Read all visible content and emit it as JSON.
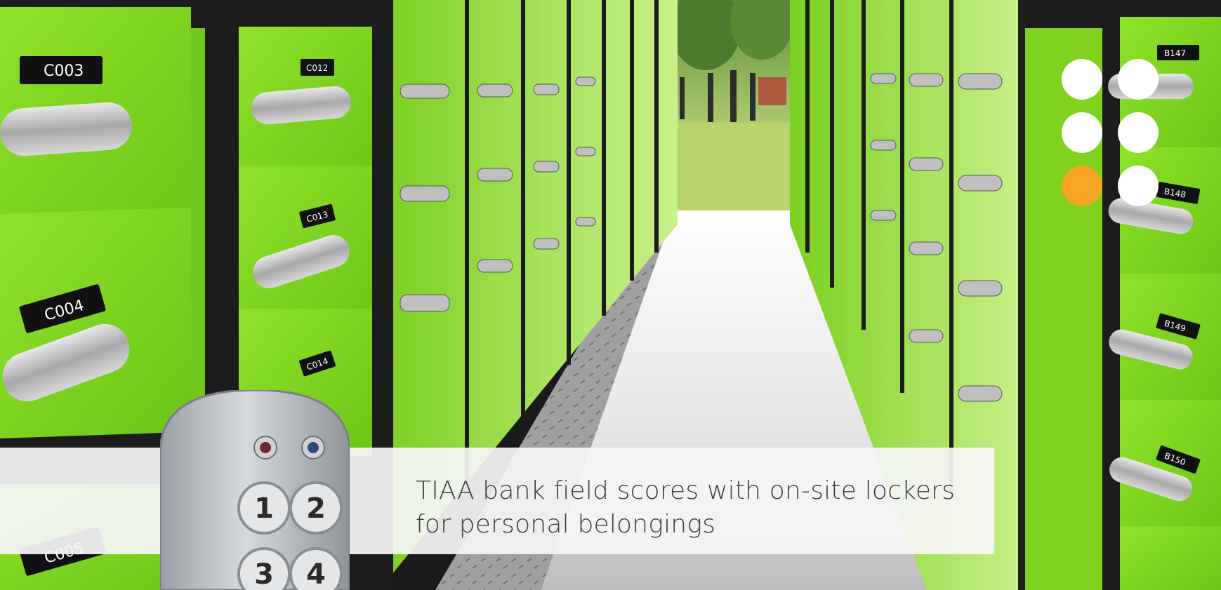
{
  "caption": {
    "line1": "TIAA bank field scores with on-site lockers",
    "line2": "for personal belongings"
  },
  "locker_labels": {
    "c003": "C003",
    "c004": "C004",
    "c005": "C005",
    "c012": "C012",
    "c013": "C013",
    "c014": "C014",
    "b147": "B147",
    "b148": "B148",
    "b149": "B149",
    "b150": "B150"
  },
  "keypad": {
    "keys": [
      "1",
      "2",
      "3",
      "4"
    ]
  },
  "colors": {
    "locker_green": "#7ed321",
    "frame_dark": "#1c1c1c",
    "dot_white": "#ffffff",
    "dot_accent": "#f5a623",
    "caption_text": "#3c3c3c"
  },
  "dots": [
    "white",
    "white",
    "white",
    "white",
    "orange",
    "white"
  ]
}
